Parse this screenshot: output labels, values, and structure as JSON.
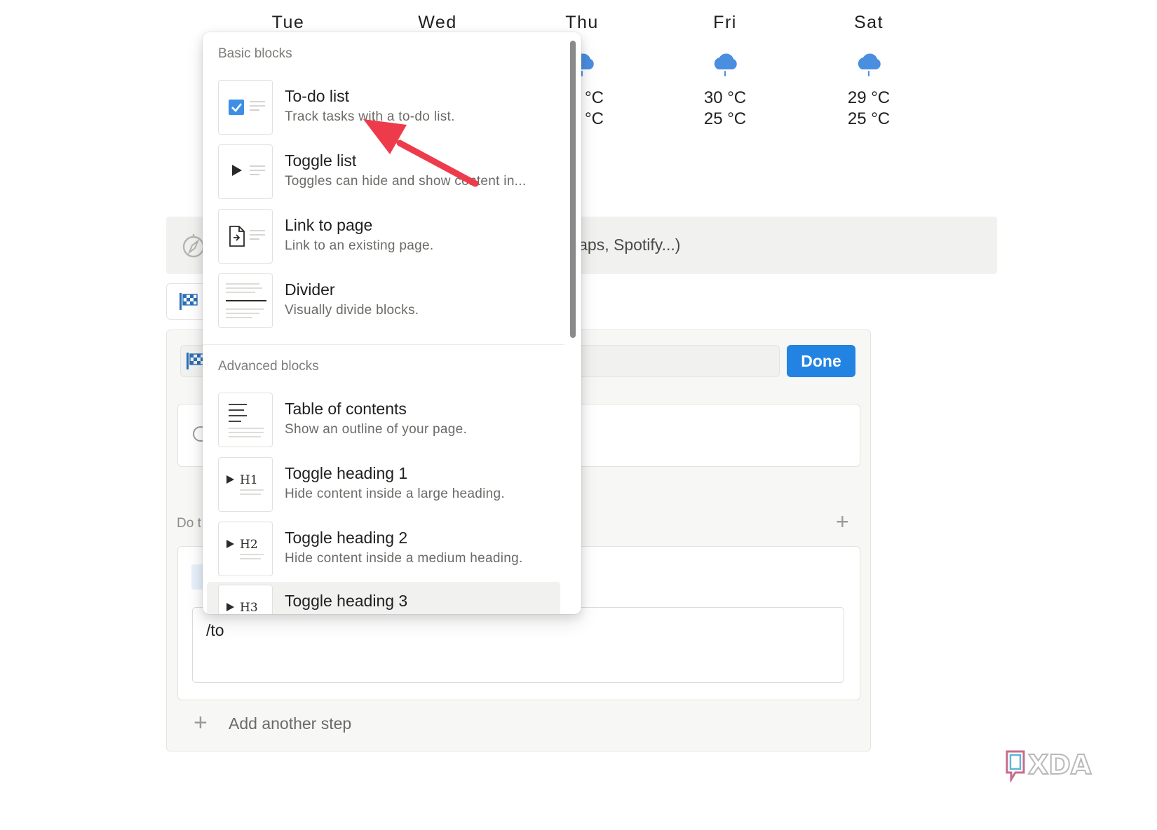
{
  "weather": {
    "days": [
      {
        "name": "Tue"
      },
      {
        "name": "Wed"
      },
      {
        "name": "Thu",
        "high": "°C",
        "low": "°C"
      },
      {
        "name": "Fri",
        "high": "30 °C",
        "low": "25 °C"
      },
      {
        "name": "Sat",
        "high": "29 °C",
        "low": "25 °C"
      }
    ],
    "icon": "rain-cloud-icon",
    "icon_color": "#4a8ee0"
  },
  "embed_bar": {
    "visible_text": "laps, Spotify...)",
    "icon": "compass-icon"
  },
  "editor": {
    "done_label": "Done",
    "steps_header_visible": "Do t",
    "text_area_value": "/to",
    "add_step_label": "Add another step"
  },
  "slash_menu": {
    "basic_label": "Basic blocks",
    "advanced_label": "Advanced blocks",
    "basic_items": [
      {
        "title": "To-do list",
        "desc": "Track tasks with a to-do list.",
        "icon": "checkbox-icon"
      },
      {
        "title": "Toggle list",
        "desc": "Toggles can hide and show content in...",
        "icon": "toggle-triangle-icon"
      },
      {
        "title": "Link to page",
        "desc": "Link to an existing page.",
        "icon": "page-link-icon"
      },
      {
        "title": "Divider",
        "desc": "Visually divide blocks.",
        "icon": "divider-icon"
      }
    ],
    "advanced_items": [
      {
        "title": "Table of contents",
        "desc": "Show an outline of your page.",
        "icon": "table-of-contents-icon"
      },
      {
        "title": "Toggle heading 1",
        "desc": "Hide content inside a large heading.",
        "icon": "toggle-h1-icon",
        "thumb_text": "H1"
      },
      {
        "title": "Toggle heading 2",
        "desc": "Hide content inside a medium heading.",
        "icon": "toggle-h2-icon",
        "thumb_text": "H2"
      },
      {
        "title": "Toggle heading 3",
        "desc": "",
        "icon": "toggle-h3-icon",
        "thumb_text": "H3"
      }
    ]
  },
  "colors": {
    "accent_blue": "#2383e2",
    "checkbox_blue": "#3d8ee6",
    "annotation_red": "#ee3b4b",
    "hover_bg": "#f1f1ef"
  },
  "watermark": {
    "text": "XDA"
  }
}
